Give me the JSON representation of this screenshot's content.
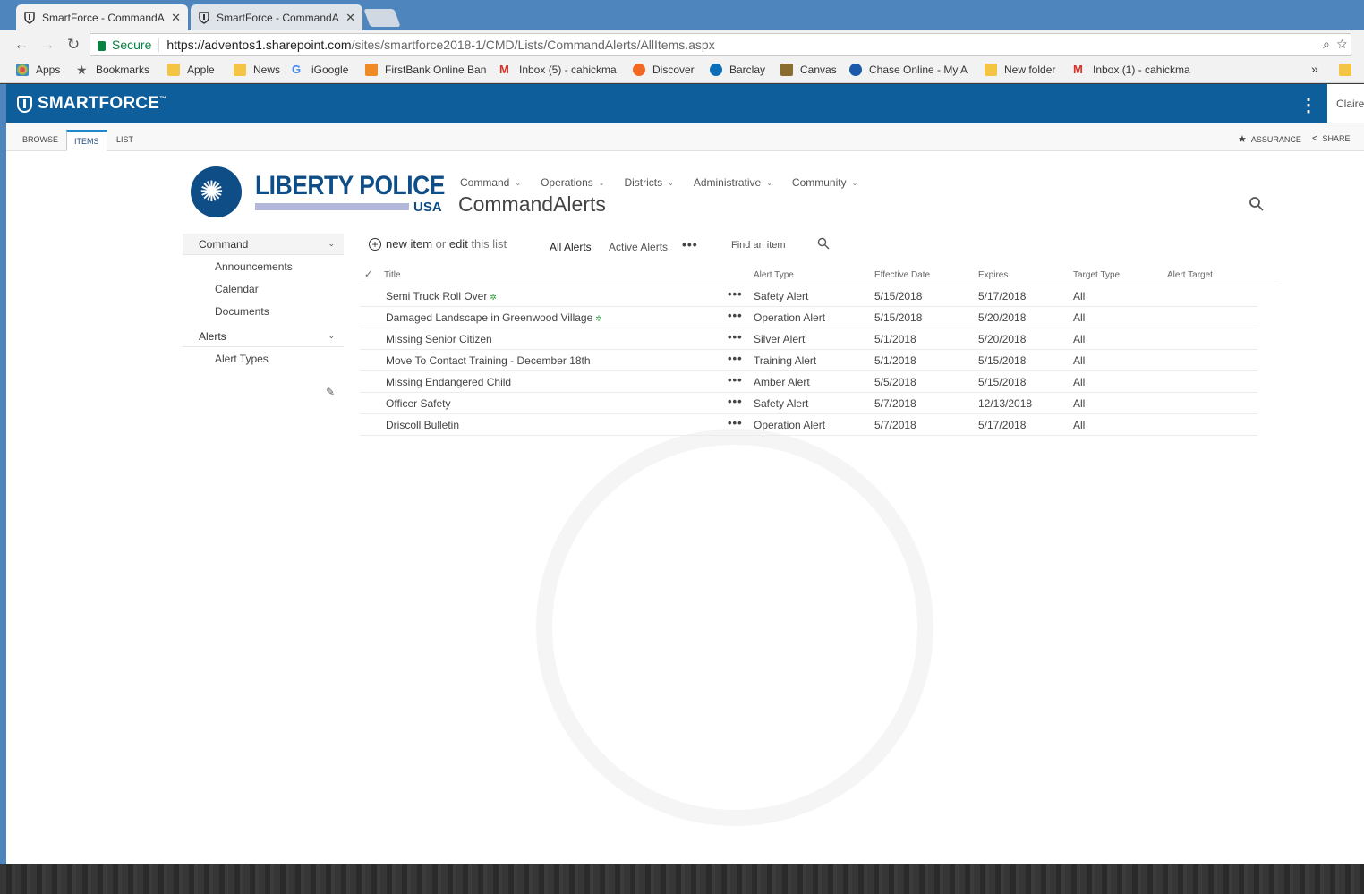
{
  "browser": {
    "tabs": [
      {
        "title": "SmartForce - CommandA",
        "active": true
      },
      {
        "title": "SmartForce - CommandA",
        "active": false
      }
    ],
    "secure_label": "Secure",
    "url_host": "https://adventos1.sharepoint.com",
    "url_path": "/sites/smartforce2018-1/CMD/Lists/CommandAlerts/AllItems.aspx",
    "bookmarks": [
      {
        "label": "Apps",
        "icon": "apps-grid-icon",
        "color": "#d9534f"
      },
      {
        "label": "Bookmarks",
        "icon": "star-icon",
        "color": "#555555"
      },
      {
        "label": "Apple",
        "icon": "folder-icon",
        "color": "#f4c542"
      },
      {
        "label": "News",
        "icon": "folder-icon",
        "color": "#f4c542"
      },
      {
        "label": "iGoogle",
        "icon": "google-icon",
        "color": "#4285f4"
      },
      {
        "label": "FirstBank Online Ban",
        "icon": "bank-icon",
        "color": "#f08a24"
      },
      {
        "label": "Inbox (5) - cahickma",
        "icon": "gmail-icon",
        "color": "#d93025"
      },
      {
        "label": "Discover",
        "icon": "discover-icon",
        "color": "#f26722"
      },
      {
        "label": "Barclay",
        "icon": "barclay-icon",
        "color": "#0a6fb7"
      },
      {
        "label": "Canvas",
        "icon": "canvas-icon",
        "color": "#8a6d2f"
      },
      {
        "label": "Chase Online - My A",
        "icon": "chase-icon",
        "color": "#1a5aa8"
      },
      {
        "label": "New folder",
        "icon": "folder-icon",
        "color": "#f4c542"
      },
      {
        "label": "Inbox (1) - cahickma",
        "icon": "gmail-icon",
        "color": "#d93025"
      }
    ],
    "overflow": "»"
  },
  "suite": {
    "brand": "SMARTFORCE",
    "brand_mark": "™",
    "user": "Claire H"
  },
  "ribbon": {
    "tabs": [
      "BROWSE",
      "ITEMS",
      "LIST"
    ],
    "active_tab": "ITEMS",
    "assurance": "ASSURANCE",
    "share": "SHARE"
  },
  "site": {
    "logo_line1": "LIBERTY POLICE",
    "logo_line2": "USA",
    "nav": [
      "Command",
      "Operations",
      "Districts",
      "Administrative",
      "Community"
    ],
    "page_title": "CommandAlerts"
  },
  "leftnav": {
    "section1": "Command",
    "section1_items": [
      "Announcements",
      "Calendar",
      "Documents"
    ],
    "section2": "Alerts",
    "section2_items": [
      "Alert Types"
    ]
  },
  "commandbar": {
    "new_item": "new item",
    "or": "or",
    "edit": "edit",
    "this_list": "this list",
    "views": [
      "All Alerts",
      "Active Alerts"
    ],
    "active_view": "All Alerts",
    "find_placeholder": "Find an item"
  },
  "grid": {
    "columns": [
      "Title",
      "Alert Type",
      "Effective Date",
      "Expires",
      "Target Type",
      "Alert Target"
    ],
    "rows": [
      {
        "title": "Semi Truck Roll Over",
        "new": true,
        "type": "Safety Alert",
        "effective": "5/15/2018",
        "expires": "5/17/2018",
        "target_type": "All",
        "target": ""
      },
      {
        "title": "Damaged Landscape in Greenwood Village",
        "new": true,
        "type": "Operation Alert",
        "effective": "5/15/2018",
        "expires": "5/20/2018",
        "target_type": "All",
        "target": ""
      },
      {
        "title": "Missing Senior Citizen",
        "new": false,
        "type": "Silver Alert",
        "effective": "5/1/2018",
        "expires": "5/20/2018",
        "target_type": "All",
        "target": ""
      },
      {
        "title": "Move To Contact Training - December 18th",
        "new": false,
        "type": "Training Alert",
        "effective": "5/1/2018",
        "expires": "5/15/2018",
        "target_type": "All",
        "target": ""
      },
      {
        "title": "Missing Endangered Child",
        "new": false,
        "type": "Amber Alert",
        "effective": "5/5/2018",
        "expires": "5/15/2018",
        "target_type": "All",
        "target": ""
      },
      {
        "title": "Officer Safety",
        "new": false,
        "type": "Safety Alert",
        "effective": "5/7/2018",
        "expires": "12/13/2018",
        "target_type": "All",
        "target": ""
      },
      {
        "title": "Driscoll Bulletin",
        "new": false,
        "type": "Operation Alert",
        "effective": "5/7/2018",
        "expires": "5/17/2018",
        "target_type": "All",
        "target": ""
      }
    ]
  },
  "colors": {
    "suitebar": "#0f5e9c",
    "chrome": "#4e85bd",
    "logo_blue": "#0f4d87",
    "accent": "#1f86d0"
  }
}
